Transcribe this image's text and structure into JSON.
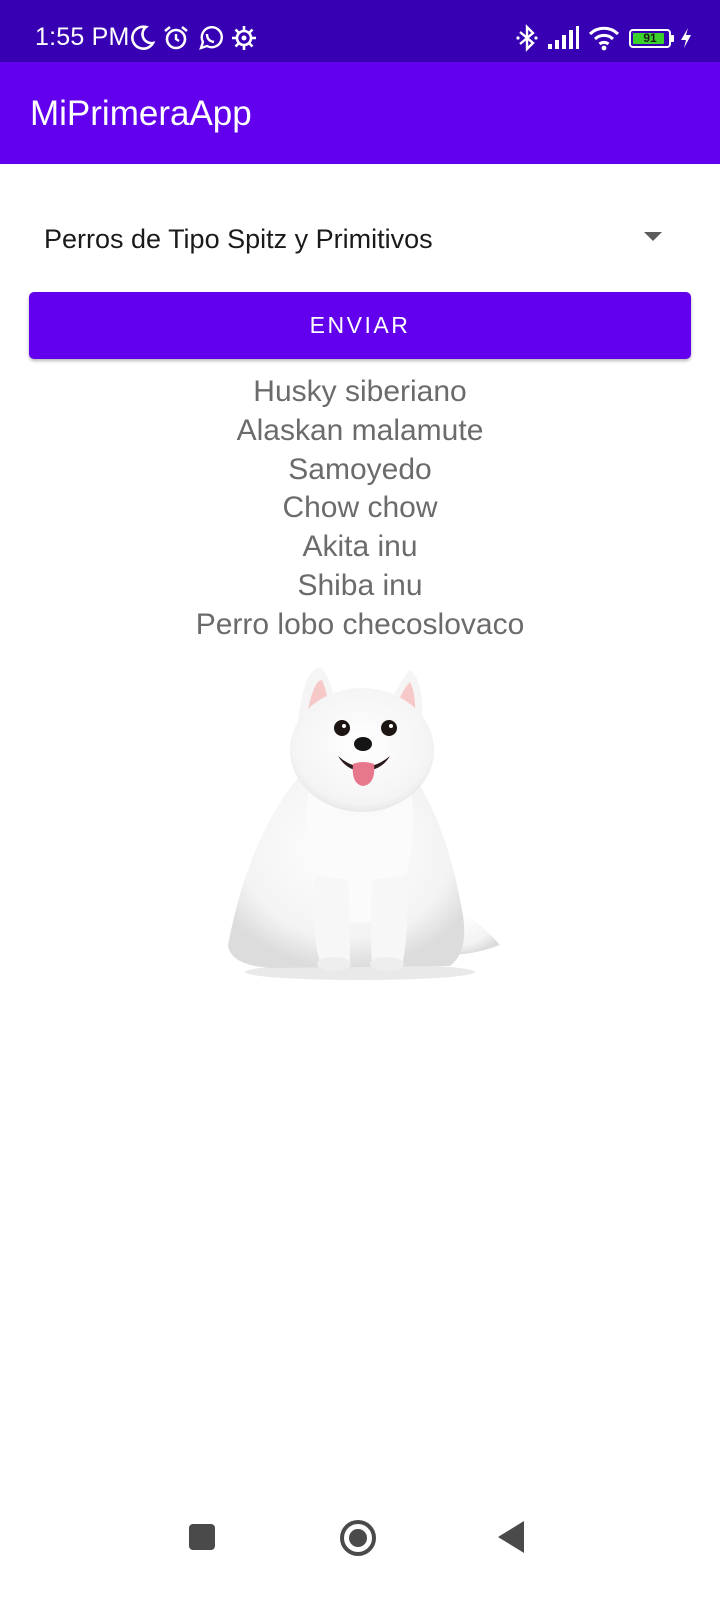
{
  "status_bar": {
    "time": "1:55 PM",
    "battery_level": "91",
    "battery_fraction": 0.91,
    "left_icons": [
      "moon-icon",
      "alarm-icon",
      "whatsapp-icon",
      "settings-gear-icon"
    ],
    "right_icons": [
      "bluetooth-icon",
      "signal-icon",
      "wifi-icon",
      "battery-icon",
      "charging-bolt-icon"
    ]
  },
  "app_bar": {
    "title": "MiPrimeraApp"
  },
  "spinner": {
    "selected": "Perros de Tipo Spitz y Primitivos"
  },
  "send_button": {
    "label": "ENVIAR"
  },
  "breeds": [
    "Husky siberiano",
    "Alaskan malamute",
    "Samoyedo",
    "Chow chow",
    "Akita inu",
    "Shiba inu",
    "Perro lobo checoslovaco"
  ],
  "image": {
    "subject": "white-spitz-dog"
  },
  "colors": {
    "status_bar": "#3700b3",
    "primary": "#6200ee",
    "breed_text": "#6b6b6b",
    "nav_icon": "#4a4a4a"
  },
  "nav_bar": {
    "buttons": [
      "recent-apps",
      "home",
      "back"
    ]
  }
}
